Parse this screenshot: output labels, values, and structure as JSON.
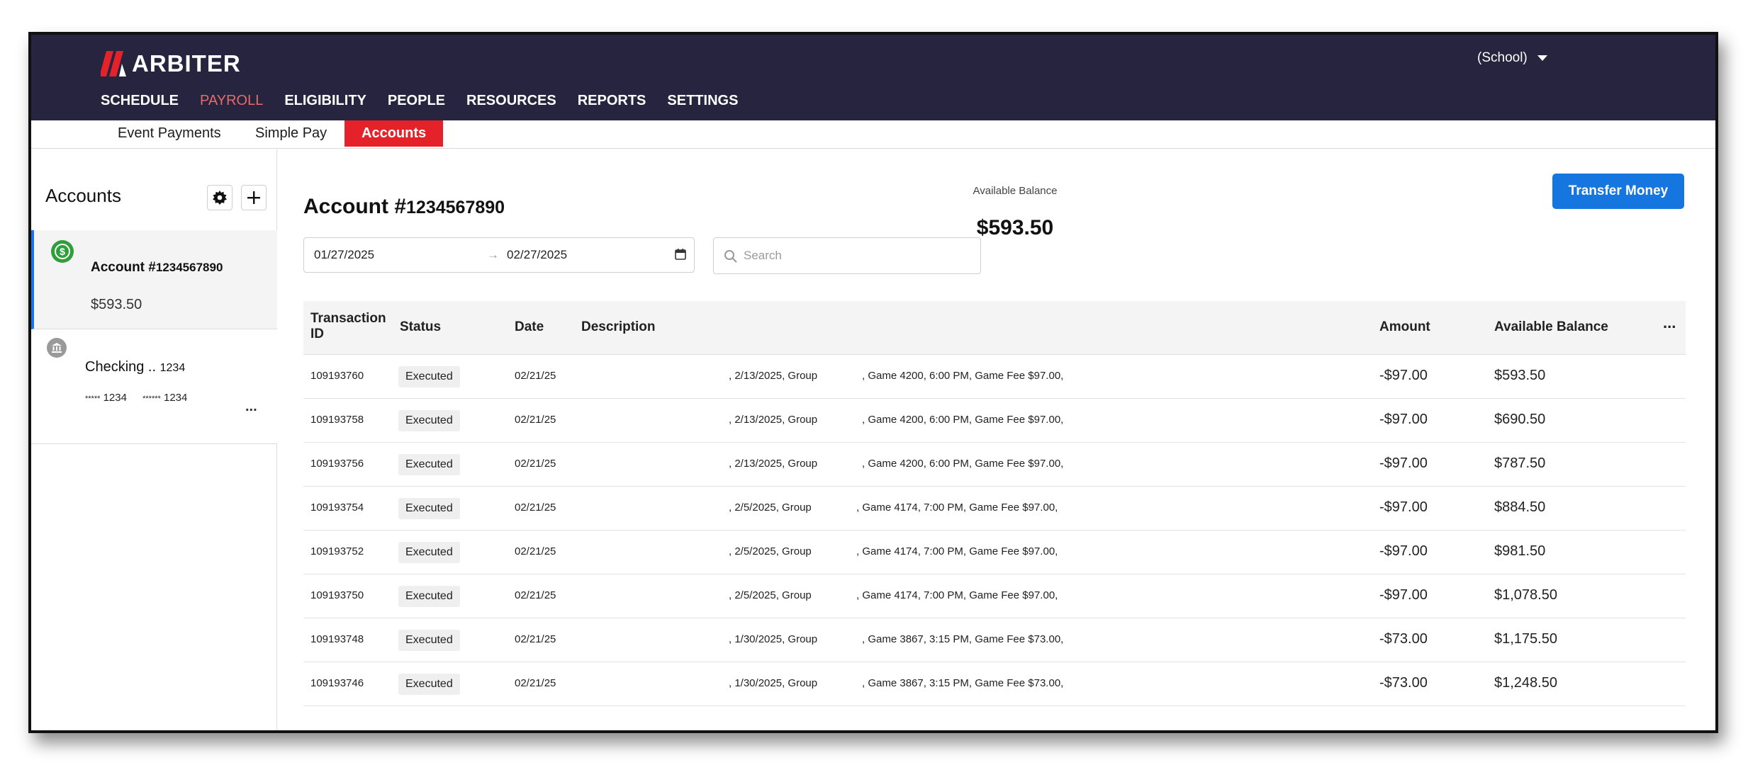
{
  "brand": {
    "name": "ARBITER",
    "accent": "#e5222a"
  },
  "org_selector": {
    "label": "(School)"
  },
  "main_nav": [
    {
      "label": "SCHEDULE",
      "active": false
    },
    {
      "label": "PAYROLL",
      "active": true
    },
    {
      "label": "ELIGIBILITY",
      "active": false
    },
    {
      "label": "PEOPLE",
      "active": false
    },
    {
      "label": "RESOURCES",
      "active": false
    },
    {
      "label": "REPORTS",
      "active": false
    },
    {
      "label": "SETTINGS",
      "active": false
    }
  ],
  "sub_nav": [
    {
      "label": "Event Payments",
      "active": false
    },
    {
      "label": "Simple Pay",
      "active": false
    },
    {
      "label": "Accounts",
      "active": true
    }
  ],
  "sidebar": {
    "title": "Accounts",
    "settings_icon": "gear-icon",
    "add_icon": "plus-icon",
    "accounts": [
      {
        "label": "Account #",
        "number": "1234567890",
        "balance": "$593.50",
        "icon": "dollar-circle-icon",
        "selected": true
      },
      {
        "label": "Checking ..",
        "number": "1234",
        "masked_1": "*****",
        "last4_1": "1234",
        "masked_2": "******",
        "last4_2": "1234",
        "icon": "bank-icon",
        "more": "..."
      }
    ]
  },
  "account": {
    "heading_label": "Account #",
    "heading_number": "1234567890",
    "balance_label": "Available Balance",
    "balance_value": "$593.50",
    "transfer_button": "Transfer Money"
  },
  "filters": {
    "date_from": "01/27/2025",
    "date_arrow": "→",
    "date_to": "02/27/2025",
    "search_placeholder": "Search"
  },
  "table": {
    "columns": [
      "Transaction ID",
      "Status",
      "Date",
      "Description",
      "Amount",
      "Available Balance"
    ],
    "column_transaction_1": "Transaction",
    "column_transaction_2": "ID",
    "more_label": "...",
    "rows": [
      {
        "id": "109193760",
        "status": "Executed",
        "date": "02/21/25",
        "desc_a": ", 2/13/2025, Group",
        "desc_b": ", Game 4200, 6:00 PM, Game Fee $97.00,",
        "amount": "-$97.00",
        "balance": "$593.50"
      },
      {
        "id": "109193758",
        "status": "Executed",
        "date": "02/21/25",
        "desc_a": ", 2/13/2025, Group",
        "desc_b": ", Game 4200, 6:00 PM, Game Fee $97.00,",
        "amount": "-$97.00",
        "balance": "$690.50"
      },
      {
        "id": "109193756",
        "status": "Executed",
        "date": "02/21/25",
        "desc_a": ", 2/13/2025, Group",
        "desc_b": ", Game 4200, 6:00 PM, Game Fee $97.00,",
        "amount": "-$97.00",
        "balance": "$787.50"
      },
      {
        "id": "109193754",
        "status": "Executed",
        "date": "02/21/25",
        "desc_a": ", 2/5/2025, Group",
        "desc_b": ", Game 4174, 7:00 PM, Game Fee $97.00,",
        "amount": "-$97.00",
        "balance": "$884.50"
      },
      {
        "id": "109193752",
        "status": "Executed",
        "date": "02/21/25",
        "desc_a": ", 2/5/2025, Group",
        "desc_b": ", Game 4174, 7:00 PM, Game Fee $97.00,",
        "amount": "-$97.00",
        "balance": "$981.50"
      },
      {
        "id": "109193750",
        "status": "Executed",
        "date": "02/21/25",
        "desc_a": ", 2/5/2025, Group",
        "desc_b": ", Game 4174, 7:00 PM, Game Fee $97.00,",
        "amount": "-$97.00",
        "balance": "$1,078.50"
      },
      {
        "id": "109193748",
        "status": "Executed",
        "date": "02/21/25",
        "desc_a": ", 1/30/2025, Group",
        "desc_b": ", Game 3867, 3:15 PM, Game Fee $73.00,",
        "amount": "-$73.00",
        "balance": "$1,175.50"
      },
      {
        "id": "109193746",
        "status": "Executed",
        "date": "02/21/25",
        "desc_a": ", 1/30/2025, Group",
        "desc_b": ", Game 3867, 3:15 PM, Game Fee $73.00,",
        "amount": "-$73.00",
        "balance": "$1,248.50"
      }
    ]
  }
}
